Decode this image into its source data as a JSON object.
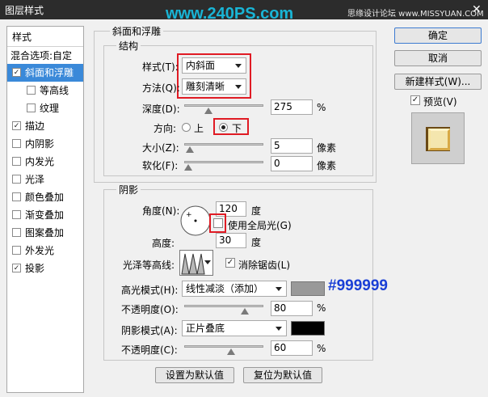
{
  "window": {
    "title": "图层样式",
    "watermark": "www.240PS.com",
    "site_credit": "思缘设计论坛  www.MISSYUAN.COM",
    "close_glyph": "✕"
  },
  "left_panel": {
    "header": "样式",
    "blend_options": "混合选项:自定",
    "items": [
      {
        "label": "斜面和浮雕",
        "checked": true
      },
      {
        "label": "等高线",
        "checked": false
      },
      {
        "label": "纹理",
        "checked": false
      },
      {
        "label": "描边",
        "checked": true
      },
      {
        "label": "内阴影",
        "checked": false
      },
      {
        "label": "内发光",
        "checked": false
      },
      {
        "label": "光泽",
        "checked": false
      },
      {
        "label": "颜色叠加",
        "checked": false
      },
      {
        "label": "渐变叠加",
        "checked": false
      },
      {
        "label": "图案叠加",
        "checked": false
      },
      {
        "label": "外发光",
        "checked": false
      },
      {
        "label": "投影",
        "checked": true
      }
    ],
    "check_glyph": "✓"
  },
  "bevel": {
    "group_title": "斜面和浮雕",
    "structure_title": "结构",
    "style_label": "样式(T):",
    "style_value": "内斜面",
    "technique_label": "方法(Q):",
    "technique_value": "雕刻清晰",
    "depth_label": "深度(D):",
    "depth_value": "275",
    "depth_unit": "%",
    "depth_slider": 0.28,
    "direction_label": "方向:",
    "direction_up": "上",
    "direction_down": "下",
    "direction_selected": "下",
    "size_label": "大小(Z):",
    "size_value": "5",
    "size_unit": "像素",
    "size_slider": 0.02,
    "soften_label": "软化(F):",
    "soften_value": "0",
    "soften_unit": "像素",
    "soften_slider": 0.0
  },
  "shading": {
    "title": "阴影",
    "angle_label": "角度(N):",
    "angle_value": "120",
    "angle_unit": "度",
    "global_light_label": "使用全局光(G)",
    "global_light_checked": false,
    "altitude_label": "高度:",
    "altitude_value": "30",
    "altitude_unit": "度",
    "gloss_label": "光泽等高线:",
    "antialias_label": "消除锯齿(L)",
    "antialias_checked": true,
    "highlight_mode_label": "高光模式(H):",
    "highlight_mode_value": "线性减淡（添加）",
    "highlight_color": "#999999",
    "highlight_color_note": "#999999",
    "highlight_opacity_label": "不透明度(O):",
    "highlight_opacity_value": "80",
    "highlight_opacity_unit": "%",
    "highlight_opacity_slider": 0.8,
    "shadow_mode_label": "阴影模式(A):",
    "shadow_mode_value": "正片叠底",
    "shadow_color": "#000000",
    "shadow_opacity_label": "不透明度(C):",
    "shadow_opacity_value": "60",
    "shadow_opacity_unit": "%",
    "shadow_opacity_slider": 0.6
  },
  "footer": {
    "make_default": "设置为默认值",
    "reset_default": "复位为默认值"
  },
  "right": {
    "ok": "确定",
    "cancel": "取消",
    "new_style": "新建样式(W)...",
    "preview_label": "预览(V)",
    "preview_checked": true
  },
  "colors": {
    "accent": "#3a89d9",
    "annotation_red": "#e01b24",
    "note_blue": "#1a3fd6"
  }
}
